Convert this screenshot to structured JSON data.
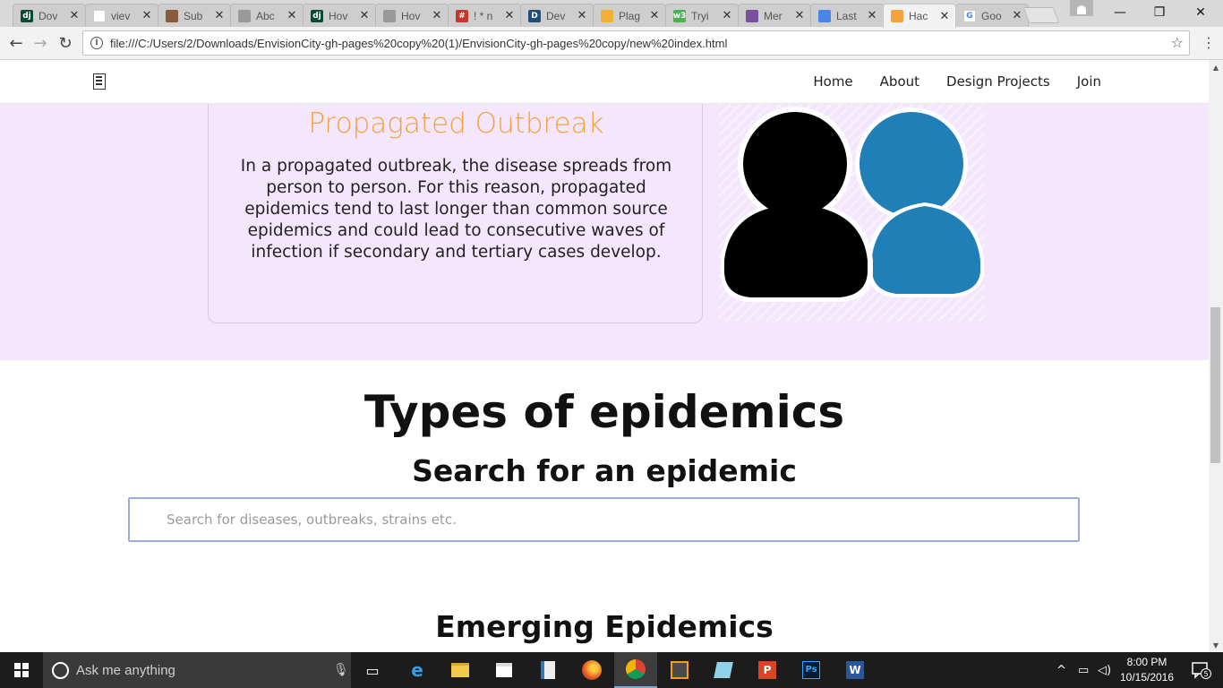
{
  "browser": {
    "tabs": [
      {
        "title": "Dov",
        "fav": "dj",
        "fav_color": "#0c4b33"
      },
      {
        "title": "viev",
        "fav": "",
        "fav_color": "#ffffff"
      },
      {
        "title": "Sub",
        "fav": "",
        "fav_color": "#8a5a3c"
      },
      {
        "title": "Abc",
        "fav": "",
        "fav_color": "#999999"
      },
      {
        "title": "Hov",
        "fav": "dj",
        "fav_color": "#0c4b33"
      },
      {
        "title": "Hov",
        "fav": "",
        "fav_color": "#999999"
      },
      {
        "title": "! * n",
        "fav": "#",
        "fav_color": "#c0392b"
      },
      {
        "title": "Dev",
        "fav": "D",
        "fav_color": "#1f4e79"
      },
      {
        "title": "Plag",
        "fav": "",
        "fav_color": "#f2b134"
      },
      {
        "title": "Tryi",
        "fav": "w3",
        "fav_color": "#4caf50"
      },
      {
        "title": "Mer",
        "fav": "",
        "fav_color": "#7b4fa0"
      },
      {
        "title": "Last",
        "fav": "",
        "fav_color": "#4a86e8"
      },
      {
        "title": "Hac",
        "fav": "",
        "fav_color": "#f5a13c"
      },
      {
        "title": "Goo",
        "fav": "G",
        "fav_color": "#ffffff"
      }
    ],
    "active_tab": 12,
    "url": "file:///C:/Users/2/Downloads/EnvisionCity-gh-pages%20copy%20(1)/EnvisionCity-gh-pages%20copy/new%20index.html",
    "controls": {
      "minimize": "—",
      "maximize": "❐",
      "close": "✕"
    }
  },
  "site": {
    "nav": [
      "Home",
      "About",
      "Design Projects",
      "Join"
    ],
    "hero": {
      "title": "Propagated Outbreak",
      "text": "In a propagated outbreak, the disease spreads from person to person. For this reason, propagated epidemics tend to last longer than common source epidemics and could lead to consecutive waves of infection if secondary and tertiary cases develop."
    },
    "section_title": "Types of epidemics",
    "search_title": "Search for an epidemic",
    "search_placeholder": "Search for diseases, outbreaks, strains etc.",
    "emerging_title": "Emerging Epidemics",
    "colors": {
      "accent": "#f5a13c",
      "hero_bg": "#f4e6fc",
      "person_blue": "#1f7fb6",
      "person_black": "#000000"
    }
  },
  "taskbar": {
    "search_text": "Ask me anything",
    "time": "8:00 PM",
    "date": "10/15/2016",
    "notification_count": "5"
  }
}
